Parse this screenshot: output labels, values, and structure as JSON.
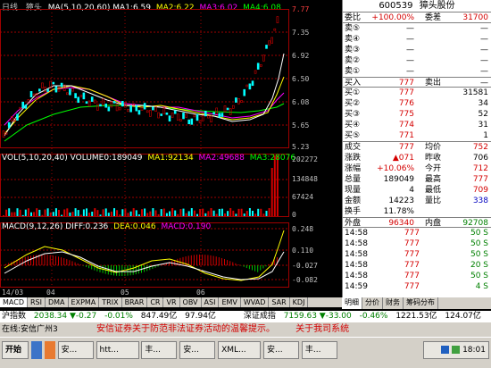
{
  "chart": {
    "period": "日线",
    "stock_name": "獐头",
    "ma_label": "MA(5,10,20,60)",
    "ma1": "MA1:6.59",
    "ma2": "MA2:6.22",
    "ma3": "MA3:6.02",
    "ma4": "MA4:6.08",
    "price_ticks": [
      "7.77",
      "7.35",
      "6.92",
      "6.50",
      "6.08",
      "5.65",
      "5.23"
    ],
    "vol_title": "VOL(5,10,20,40)",
    "vol_value": "VOLUME0:189049",
    "vol_ma1": "MA1:92134",
    "vol_ma2": "MA2:49688",
    "vol_ma3": "MA3:28076",
    "vol_ticks": [
      "202272",
      "134848",
      "67424",
      "0"
    ],
    "macd_title": "MACD(9,12,26)",
    "macd_diff": "DIFF:0.236",
    "macd_dea": "DEA:0.046",
    "macd_val": "MACD:0.190",
    "macd_ticks": [
      "0.248",
      "0.110",
      "-0.027",
      "-0.082"
    ],
    "date_labels": [
      "14/03",
      "04",
      "05",
      "06"
    ],
    "tabs": [
      "MACD",
      "RSI",
      "DMA",
      "EXPMA",
      "TRIX",
      "BRAR",
      "CR",
      "VR",
      "OBV",
      "ASI",
      "EMV",
      "WVAD",
      "SAR",
      "KDJ"
    ]
  },
  "panel": {
    "code": "600539",
    "name": "獐头股份",
    "weibi_label": "委比",
    "weibi_value": "+100.00%",
    "weicha_label": "委差",
    "weicha_value": "31700",
    "sell": [
      {
        "label": "卖⑤",
        "price": "—",
        "vol": "—"
      },
      {
        "label": "卖④",
        "price": "—",
        "vol": "—"
      },
      {
        "label": "卖③",
        "price": "—",
        "vol": "—"
      },
      {
        "label": "卖②",
        "price": "—",
        "vol": "—"
      },
      {
        "label": "卖①",
        "price": "—",
        "vol": "—"
      }
    ],
    "buy_in_label": "买入",
    "buy_in_price": "777",
    "sell_out_label": "卖出",
    "sell_out_value": "—",
    "buy": [
      {
        "label": "买①",
        "price": "777",
        "vol": "31581"
      },
      {
        "label": "买②",
        "price": "776",
        "vol": "34"
      },
      {
        "label": "买③",
        "price": "775",
        "vol": "52"
      },
      {
        "label": "买④",
        "price": "774",
        "vol": "31"
      },
      {
        "label": "买⑤",
        "price": "771",
        "vol": "1"
      }
    ],
    "stats": [
      {
        "l1": "成交",
        "v1": "777",
        "l2": "均价",
        "v2": "752",
        "c1": "red",
        "c2": "red"
      },
      {
        "l1": "涨跌",
        "v1": "▲071",
        "l2": "昨收",
        "v2": "706",
        "c1": "red",
        "c2": "blk"
      },
      {
        "l1": "涨幅",
        "v1": "+10.06%",
        "l2": "今开",
        "v2": "712",
        "c1": "red",
        "c2": "red"
      },
      {
        "l1": "总量",
        "v1": "189049",
        "l2": "最高",
        "v2": "777",
        "c1": "blk",
        "c2": "red"
      },
      {
        "l1": "现量",
        "v1": "4",
        "l2": "最低",
        "v2": "709",
        "c1": "blk",
        "c2": "red"
      },
      {
        "l1": "金额",
        "v1": "14223",
        "l2": "量比",
        "v2": "338",
        "c1": "blk",
        "c2": "blue"
      }
    ],
    "turnover_label": "换手",
    "turnover_value": "11.78%",
    "outer_label": "外盘",
    "outer_value": "96340",
    "inner_label": "内盘",
    "inner_value": "92708",
    "ticks": [
      {
        "time": "14:58",
        "price": "777",
        "vol": "50 S"
      },
      {
        "time": "14:58",
        "price": "777",
        "vol": "50 S"
      },
      {
        "time": "14:58",
        "price": "777",
        "vol": "50 S"
      },
      {
        "time": "14:58",
        "price": "777",
        "vol": "20 S"
      },
      {
        "time": "14:58",
        "price": "777",
        "vol": "50 S"
      },
      {
        "time": "14:59",
        "price": "777",
        "vol": "4 S"
      }
    ],
    "panel_tabs": [
      "明细",
      "分价",
      "财务",
      "筹码分布"
    ]
  },
  "status": {
    "index1_name": "沪指数",
    "index1_value": "2038.34",
    "index1_change": "▼-0.27",
    "index1_pct": "-0.01%",
    "index1_amount": "847.49亿",
    "index1_amount2": "97.94亿",
    "index2_name": "深证成指",
    "index2_value": "7159.63",
    "index2_change": "▼-33.00",
    "index2_pct": "-0.46%",
    "index2_amount": "1221.53亿",
    "index2_amount2": "124.07亿"
  },
  "ticker": {
    "left": "在线:安信广州3",
    "msg1": "安信证券关于防范非法证券活动的温馨提示。",
    "msg2": "关于我司系统"
  },
  "taskbar": {
    "start": "开始",
    "tasks": [
      "安...",
      "htt...",
      "丰...",
      "安...",
      "XML...",
      "安...",
      "丰..."
    ],
    "clock": "18:01"
  },
  "colors": {
    "up": "#d40000",
    "down": "#00ffff",
    "ma1": "#ffffff",
    "ma2": "#ffff00",
    "ma3": "#ff00ff",
    "ma4": "#00ff00"
  }
}
